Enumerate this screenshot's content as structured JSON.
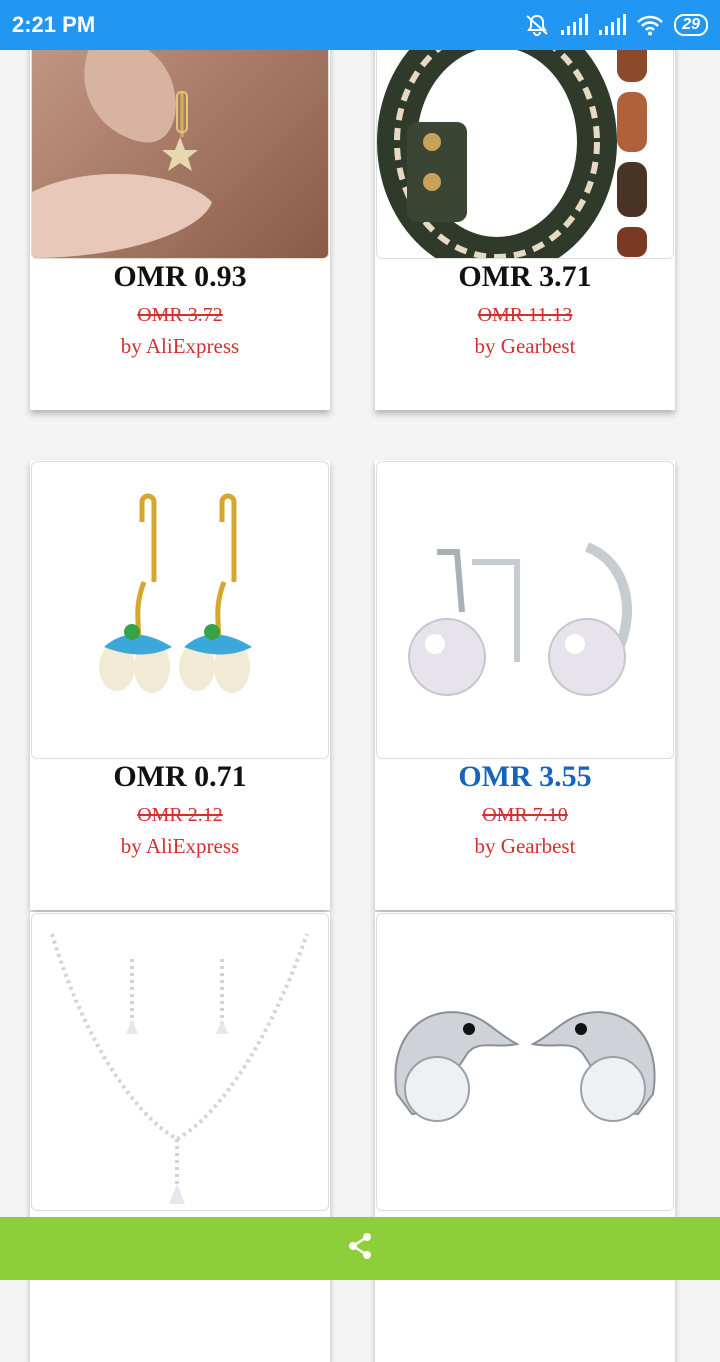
{
  "status_bar": {
    "time": "2:21 PM",
    "battery": "29",
    "icons": [
      "mute-bell-icon",
      "signal-icon",
      "signal-icon",
      "wifi-icon",
      "battery-icon"
    ]
  },
  "products": [
    {
      "price": "OMR 0.93",
      "old_price": "OMR 3.72",
      "seller": "by AliExpress",
      "image": "star-earring-photo"
    },
    {
      "price": "OMR 3.71",
      "old_price": "OMR 11.13",
      "seller": "by Gearbest",
      "image": "leather-bracelet-photo"
    },
    {
      "price": "OMR 0.71",
      "old_price": "OMR 2.12",
      "seller": "by AliExpress",
      "image": "flower-earrings-photo"
    },
    {
      "price": "OMR 3.55",
      "old_price": "OMR 7.10",
      "seller": "by Gearbest",
      "image": "pearl-earrings-photo",
      "price_color": "#1565c0"
    },
    {
      "price": "",
      "old_price": "",
      "seller": "",
      "image": "necklace-set-photo"
    },
    {
      "price": "",
      "old_price": "",
      "seller": "",
      "image": "dolphin-earrings-photo"
    }
  ],
  "bottom_bar": {
    "icon": "share-icon",
    "color": "#8dce3a"
  },
  "colors": {
    "status_bar": "#2196f3",
    "old_price": "#d32f2f",
    "seller": "#d32f2f"
  }
}
